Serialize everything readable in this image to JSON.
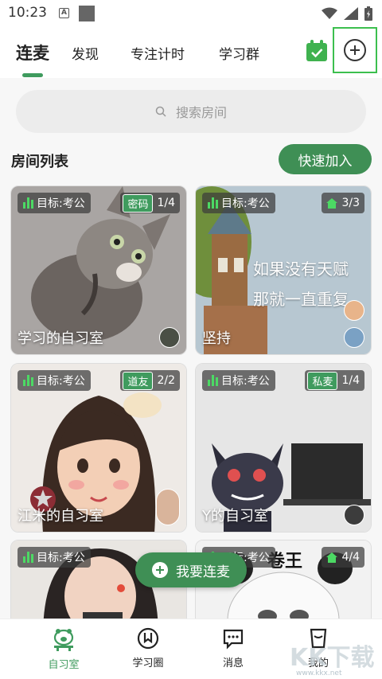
{
  "status_bar": {
    "time": "10:23",
    "a_icon_letter": "A"
  },
  "header": {
    "tabs": [
      {
        "label": "连麦",
        "active": true
      },
      {
        "label": "发现",
        "active": false
      },
      {
        "label": "专注计时",
        "active": false
      },
      {
        "label": "学习群",
        "active": false
      }
    ],
    "accent_color": "#3f9b5e"
  },
  "search": {
    "placeholder": "搜索房间"
  },
  "rooms_section": {
    "title": "房间列表",
    "quick_join_label": "快速加入"
  },
  "rooms": [
    {
      "goal": "目标:考公",
      "tag": "密码",
      "occupancy": "1/4",
      "name": "学习的自习室"
    },
    {
      "goal": "目标:考公",
      "tag": "",
      "occupancy": "3/3",
      "name": "坚持",
      "image_text": "如果没有天赋 那就一直重复"
    },
    {
      "goal": "目标:考公",
      "tag": "道友",
      "occupancy": "2/2",
      "name": "江米的自习室"
    },
    {
      "goal": "目标:考公",
      "tag": "私麦",
      "occupancy": "1/4",
      "name": "Y的自习室"
    },
    {
      "goal": "目标:考公",
      "tag": "",
      "occupancy": "",
      "name": ""
    },
    {
      "goal": "目标:考公",
      "tag": "",
      "occupancy": "4/4",
      "name": "",
      "image_text": "卷王"
    }
  ],
  "fab": {
    "label": "我要连麦"
  },
  "bottom_nav": [
    {
      "label": "自习室",
      "icon": "pig-desk-icon",
      "active": true
    },
    {
      "label": "学习圈",
      "icon": "bookmark-circle-icon",
      "active": false
    },
    {
      "label": "消息",
      "icon": "chat-bubble-icon",
      "active": false
    },
    {
      "label": "我的",
      "icon": "profile-icon",
      "active": false
    }
  ],
  "watermark": {
    "text": "www.kkx.net",
    "logo_text": "KK下载"
  }
}
